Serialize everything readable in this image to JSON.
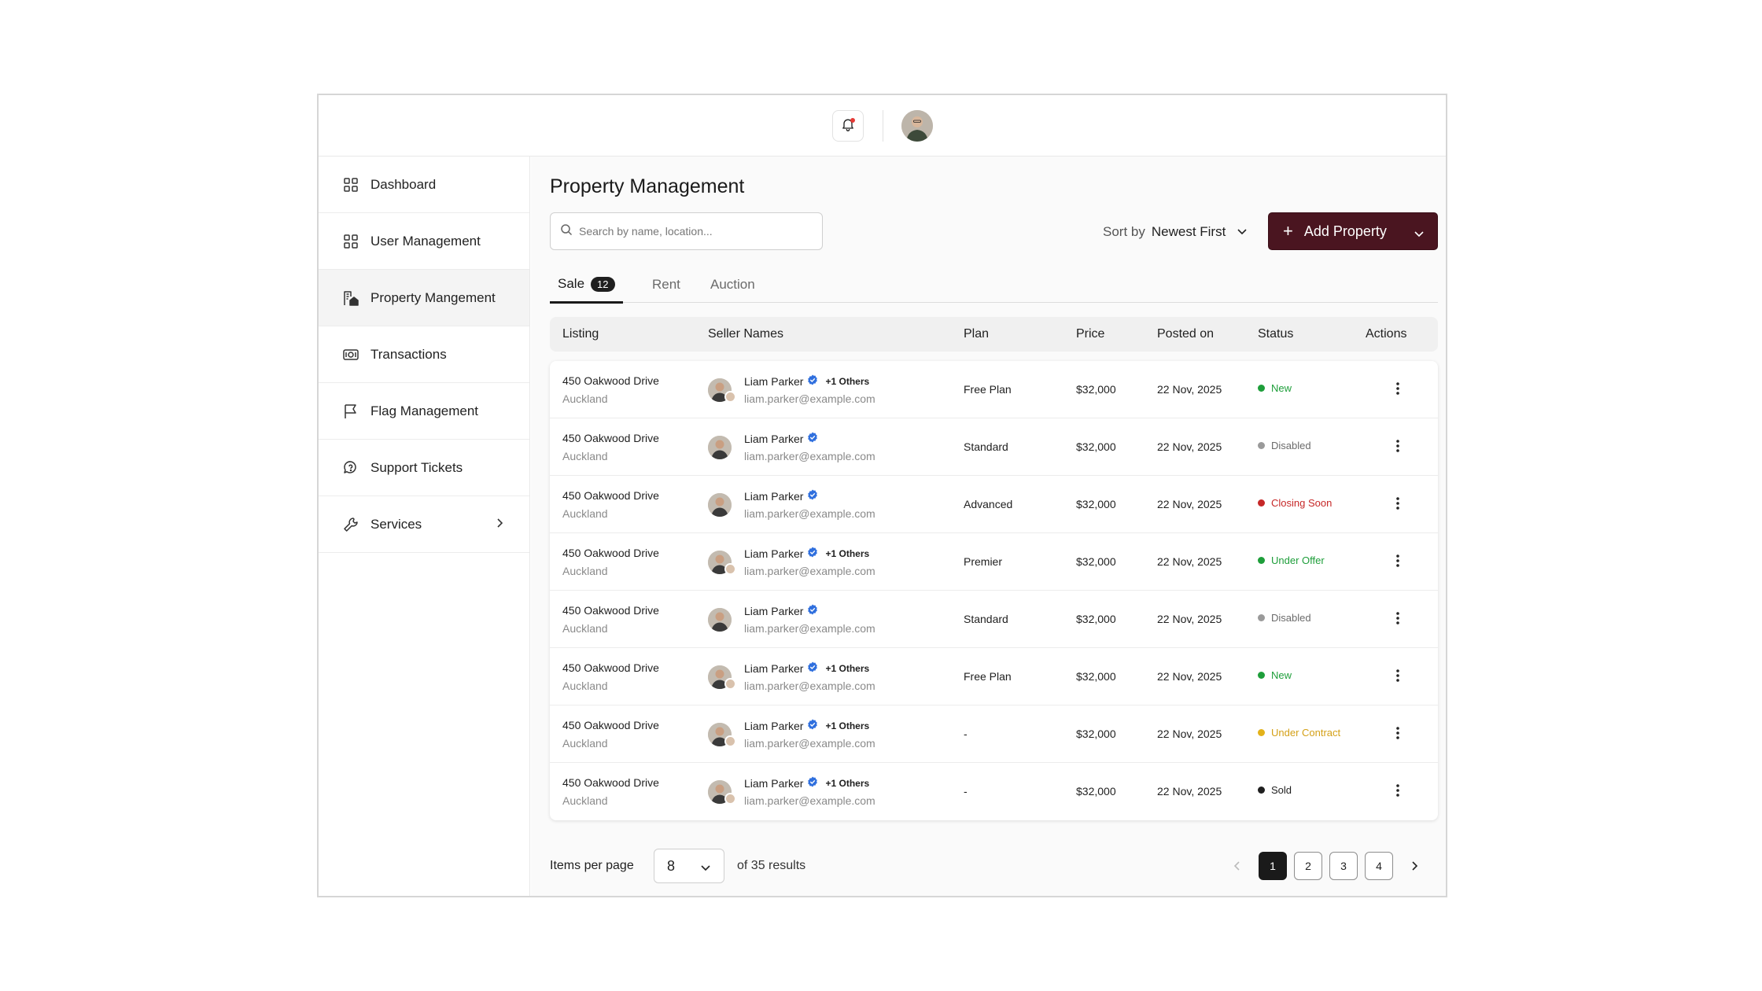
{
  "header": {
    "notification_icon": "bell-icon",
    "avatar": "user-avatar"
  },
  "sidebar": {
    "items": [
      {
        "label": "Dashboard",
        "icon": "grid-icon",
        "active": false
      },
      {
        "label": "User Management",
        "icon": "grid-icon",
        "active": false
      },
      {
        "label": "Property Mangement",
        "icon": "building-icon",
        "active": true
      },
      {
        "label": "Transactions",
        "icon": "cash-icon",
        "active": false
      },
      {
        "label": "Flag Management",
        "icon": "flag-icon",
        "active": false
      },
      {
        "label": "Support Tickets",
        "icon": "chat-icon",
        "active": false
      },
      {
        "label": "Services",
        "icon": "wrench-icon",
        "active": false
      }
    ]
  },
  "main": {
    "title": "Property Management",
    "search_placeholder": "Search by name, location...",
    "sort_label": "Sort by",
    "sort_value": "Newest First",
    "add_button": "Add Property",
    "tabs": [
      {
        "label": "Sale",
        "badge": "12",
        "active": true
      },
      {
        "label": "Rent",
        "active": false
      },
      {
        "label": "Auction",
        "active": false
      }
    ],
    "columns": [
      "Listing",
      "Seller Names",
      "Plan",
      "Price",
      "Posted on",
      "Status",
      "Actions"
    ],
    "rows": [
      {
        "address": "450 Oakwood Drive",
        "city": "Auckland",
        "seller": "Liam Parker",
        "others": "+1 Others",
        "email": "liam.parker@example.com",
        "plan": "Free Plan",
        "price": "$32,000",
        "posted": "22 Nov, 2025",
        "status": "New",
        "status_color": "#1e9e3a",
        "dot_color": "#1e9e3a"
      },
      {
        "address": "450 Oakwood Drive",
        "city": "Auckland",
        "seller": "Liam Parker",
        "others": "",
        "email": "liam.parker@example.com",
        "plan": "Standard",
        "price": "$32,000",
        "posted": "22 Nov, 2025",
        "status": "Disabled",
        "status_color": "#6b6b6b",
        "dot_color": "#9a9a9a"
      },
      {
        "address": "450 Oakwood Drive",
        "city": "Auckland",
        "seller": "Liam Parker",
        "others": "",
        "email": "liam.parker@example.com",
        "plan": "Advanced",
        "price": "$32,000",
        "posted": "22 Nov, 2025",
        "status": "Closing Soon",
        "status_color": "#c62828",
        "dot_color": "#c62828"
      },
      {
        "address": "450 Oakwood Drive",
        "city": "Auckland",
        "seller": "Liam Parker",
        "others": "+1 Others",
        "email": "liam.parker@example.com",
        "plan": "Premier",
        "price": "$32,000",
        "posted": "22 Nov, 2025",
        "status": "Under Offer",
        "status_color": "#1e9e3a",
        "dot_color": "#1e9e3a"
      },
      {
        "address": "450 Oakwood Drive",
        "city": "Auckland",
        "seller": "Liam Parker",
        "others": "",
        "email": "liam.parker@example.com",
        "plan": "Standard",
        "price": "$32,000",
        "posted": "22 Nov, 2025",
        "status": "Disabled",
        "status_color": "#6b6b6b",
        "dot_color": "#9a9a9a"
      },
      {
        "address": "450 Oakwood Drive",
        "city": "Auckland",
        "seller": "Liam Parker",
        "others": "+1 Others",
        "email": "liam.parker@example.com",
        "plan": "Free Plan",
        "price": "$32,000",
        "posted": "22 Nov, 2025",
        "status": "New",
        "status_color": "#1e9e3a",
        "dot_color": "#1e9e3a"
      },
      {
        "address": "450 Oakwood Drive",
        "city": "Auckland",
        "seller": "Liam Parker",
        "others": "+1 Others",
        "email": "liam.parker@example.com",
        "plan": "-",
        "price": "$32,000",
        "posted": "22 Nov, 2025",
        "status": "Under Contract",
        "status_color": "#d4a017",
        "dot_color": "#e3b21a"
      },
      {
        "address": "450 Oakwood Drive",
        "city": "Auckland",
        "seller": "Liam Parker",
        "others": "+1 Others",
        "email": "liam.parker@example.com",
        "plan": "-",
        "price": "$32,000",
        "posted": "22 Nov, 2025",
        "status": "Sold",
        "status_color": "#1f1f1f",
        "dot_color": "#1f1f1f"
      }
    ],
    "footer": {
      "items_per_page_label": "Items per page",
      "items_per_page_value": "8",
      "results_text": "of 35 results",
      "pages": [
        "1",
        "2",
        "3",
        "4"
      ],
      "current_page": "1"
    }
  },
  "colors": {
    "accent": "#4a1520",
    "verified": "#2f6fde"
  }
}
